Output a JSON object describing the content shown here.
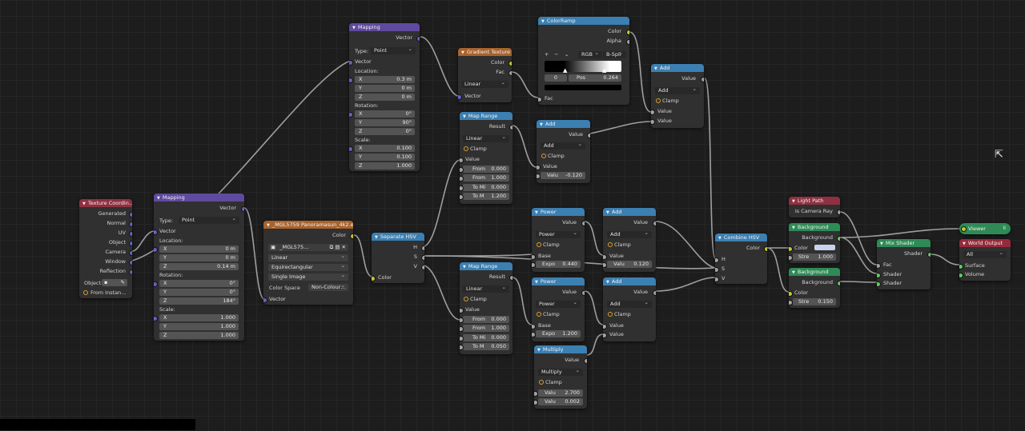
{
  "nodes": {
    "tex_coord": {
      "title": "Texture Coordin…",
      "outputs": [
        "Generated",
        "Normal",
        "UV",
        "Object",
        "Camera",
        "Window",
        "Reflection"
      ],
      "object_label": "Object:",
      "from_instancer": "From Instan…"
    },
    "mapping1": {
      "title": "Mapping",
      "output": "Vector",
      "type_label": "Type:",
      "type_value": "Point",
      "input": "Vector",
      "location_label": "Location:",
      "location": [
        "0 m",
        "0 m",
        "0.14 m"
      ],
      "rotation_label": "Rotation:",
      "rotation": [
        "0°",
        "0°",
        "184°"
      ],
      "scale_label": "Scale:",
      "scale": [
        "1.000",
        "1.000",
        "1.000"
      ]
    },
    "mapping2": {
      "title": "Mapping",
      "output": "Vector",
      "type_label": "Type:",
      "type_value": "Point",
      "input": "Vector",
      "location_label": "Location:",
      "location": [
        "0.3 m",
        "0 m",
        "0 m"
      ],
      "rotation_label": "Rotation:",
      "rotation": [
        "0°",
        "90°",
        "0°"
      ],
      "scale_label": "Scale:",
      "scale": [
        "0.100",
        "0.100",
        "1.000"
      ]
    },
    "axes": [
      "X",
      "Y",
      "Z"
    ],
    "env_tex": {
      "title": "_MGL5759 Panoramasun_4k2.exr",
      "output": "Color",
      "image_name": "_MGL575…",
      "interpolation": "Linear",
      "projection": "Equirectangular",
      "source": "Single Image",
      "colorspace_label": "Color Space",
      "colorspace_value": "Non-Colour…",
      "input": "Vector"
    },
    "sep_hsv": {
      "title": "Separate HSV",
      "outputs": [
        "H",
        "S",
        "V"
      ],
      "input": "Color"
    },
    "gradient": {
      "title": "Gradient Texture",
      "outputs": [
        "Color",
        "Fac"
      ],
      "type": "Linear",
      "input": "Vector"
    },
    "colorramp": {
      "title": "ColorRamp",
      "outputs": [
        "Color",
        "Alpha"
      ],
      "add_btn": "+",
      "remove_btn": "−",
      "menu": "⌄",
      "mode": "RGB",
      "interp": "B-Spli",
      "stop_index": "0",
      "pos_label": "Pos",
      "pos_value": "0.264",
      "input": "Fac"
    },
    "maprange1": {
      "title": "Map Range",
      "output": "Result",
      "type": "Linear",
      "clamp": "Clamp",
      "input": "Value",
      "fields": [
        {
          "l": "From",
          "v": "0.000"
        },
        {
          "l": "From",
          "v": "1.000"
        },
        {
          "l": "To Mi",
          "v": "0.000"
        },
        {
          "l": "To M",
          "v": "1.200"
        }
      ]
    },
    "maprange2": {
      "title": "Map Range",
      "output": "Result",
      "type": "Linear",
      "clamp": "Clamp",
      "input": "Value",
      "fields": [
        {
          "l": "From",
          "v": "0.000"
        },
        {
          "l": "From",
          "v": "1.000"
        },
        {
          "l": "To Mi",
          "v": "0.000"
        },
        {
          "l": "To M",
          "v": "0.050"
        }
      ]
    },
    "add_a": {
      "title": "Add",
      "output": "Value",
      "op": "Add",
      "clamp": "Clamp",
      "input": "Value",
      "field_l": "Valu",
      "field_v": "-0.120"
    },
    "add_top": {
      "title": "Add",
      "output": "Value",
      "op": "Add",
      "clamp": "Clamp",
      "inputs": [
        "Value",
        "Value"
      ]
    },
    "power1": {
      "title": "Power",
      "output": "Value",
      "op": "Power",
      "clamp": "Clamp",
      "input": "Base",
      "field_l": "Expo",
      "field_v": "0.440"
    },
    "add_b": {
      "title": "Add",
      "output": "Value",
      "op": "Add",
      "clamp": "Clamp",
      "input": "Value",
      "field_l": "Valu",
      "field_v": "0.120"
    },
    "power2": {
      "title": "Power",
      "output": "Value",
      "op": "Power",
      "clamp": "Clamp",
      "input": "Base",
      "field_l": "Expo",
      "field_v": "1.200"
    },
    "add_c": {
      "title": "Add",
      "output": "Value",
      "op": "Add",
      "clamp": "Clamp",
      "inputs": [
        "Value",
        "Value"
      ]
    },
    "multiply": {
      "title": "Multiply",
      "output": "Value",
      "op": "Multiply",
      "clamp": "Clamp",
      "fields": [
        {
          "l": "Valu",
          "v": "2.700"
        },
        {
          "l": "Valu",
          "v": "0.002"
        }
      ]
    },
    "combine_hsv": {
      "title": "Combine HSV",
      "output": "Color",
      "inputs": [
        "H",
        "S",
        "V"
      ]
    },
    "light_path": {
      "title": "Light Path",
      "output": "Is Camera Ray"
    },
    "bg1": {
      "title": "Background",
      "output": "Background",
      "color_label": "Color",
      "field_l": "Stre",
      "field_v": "1.000",
      "color_hex": "#c9d2ec"
    },
    "bg2": {
      "title": "Background",
      "output": "Background",
      "color_label": "Color",
      "field_l": "Stre",
      "field_v": "0.150"
    },
    "mix_shader": {
      "title": "Mix Shader",
      "output": "Shader",
      "inputs": [
        "Fac",
        "Shader",
        "Shader"
      ]
    },
    "viewer": {
      "title": "Viewer",
      "pause_icon": "II"
    },
    "world_output": {
      "title": "World Output",
      "target": "All",
      "inputs": [
        "Surface",
        "Volume"
      ]
    }
  },
  "colors": {
    "input": "#903040",
    "vector": "#5f4a9e",
    "texture": "#a8632d",
    "converter": "#3c7fb1",
    "shader": "#2f8a56",
    "output": "#962a3a",
    "link": "#b5b5b5"
  }
}
